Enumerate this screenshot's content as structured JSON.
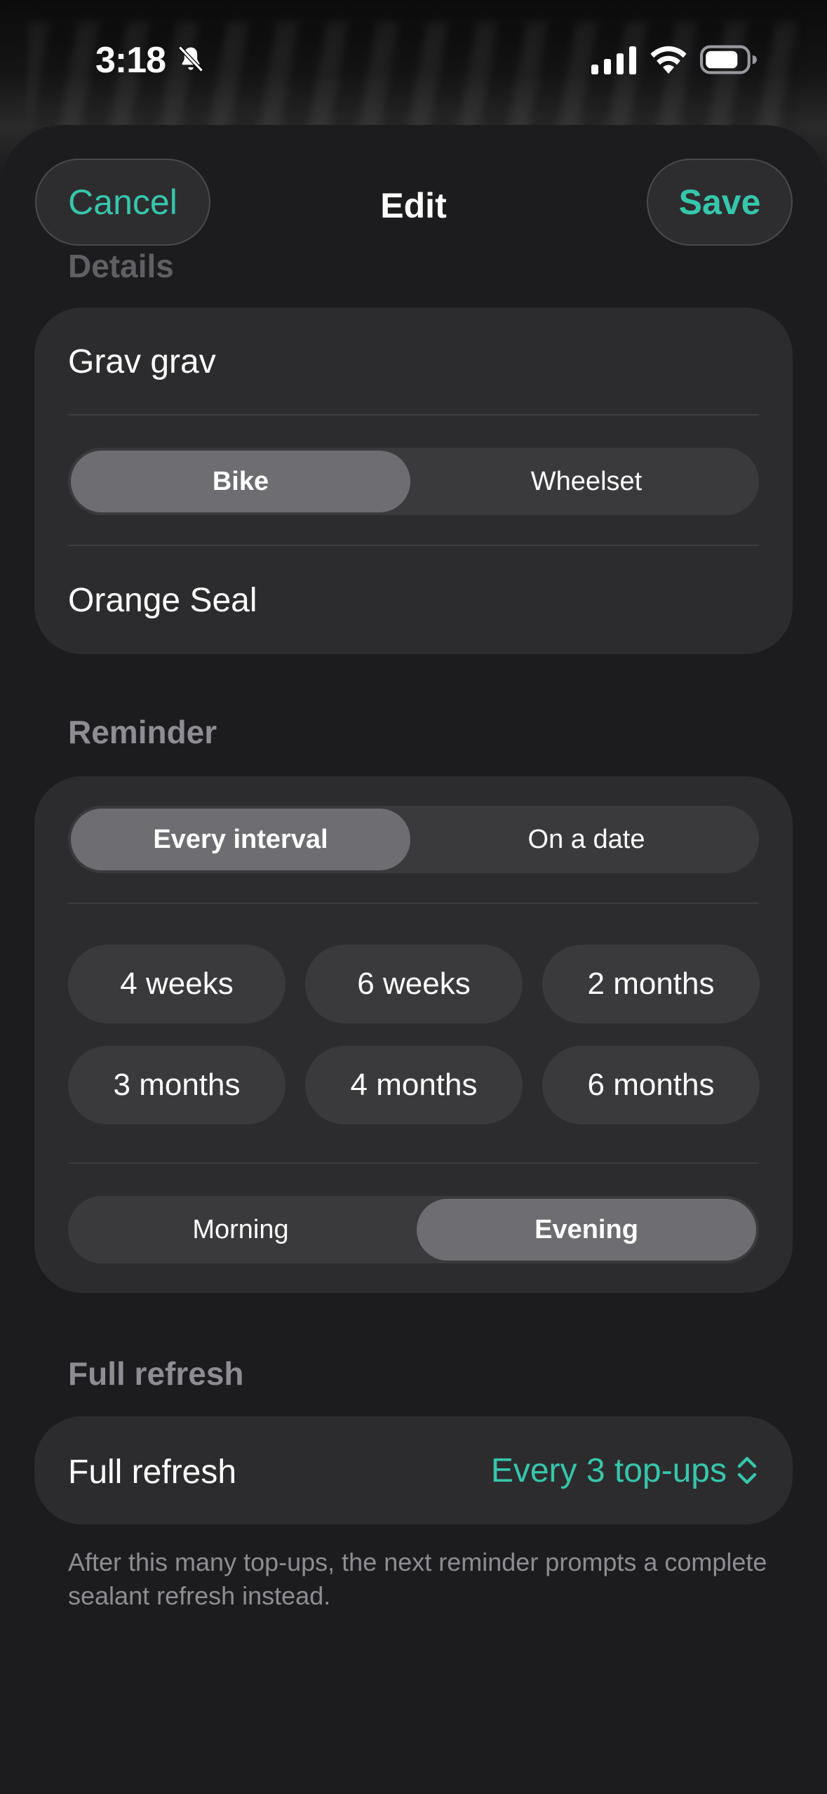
{
  "status_bar": {
    "time": "3:18"
  },
  "nav": {
    "cancel": "Cancel",
    "title": "Edit",
    "save": "Save"
  },
  "colors": {
    "accent": "#36c7ab",
    "sheet": "#1c1c1e",
    "card": "#2c2c2e"
  },
  "details": {
    "label": "Details",
    "name": "Grav grav",
    "type_options": [
      "Bike",
      "Wheelset"
    ],
    "type_selected": "Bike",
    "sealant": "Orange Seal"
  },
  "reminder": {
    "label": "Reminder",
    "mode_options": [
      "Every interval",
      "On a date"
    ],
    "mode_selected": "Every interval",
    "intervals": [
      "4 weeks",
      "6 weeks",
      "2 months",
      "3 months",
      "4 months",
      "6 months"
    ],
    "time_options": [
      "Morning",
      "Evening"
    ],
    "time_selected": "Evening"
  },
  "full_refresh": {
    "label": "Full refresh",
    "row_label": "Full refresh",
    "value": "Every 3 top-ups",
    "footnote": "After this many top-ups, the next reminder prompts a complete sealant refresh instead."
  }
}
